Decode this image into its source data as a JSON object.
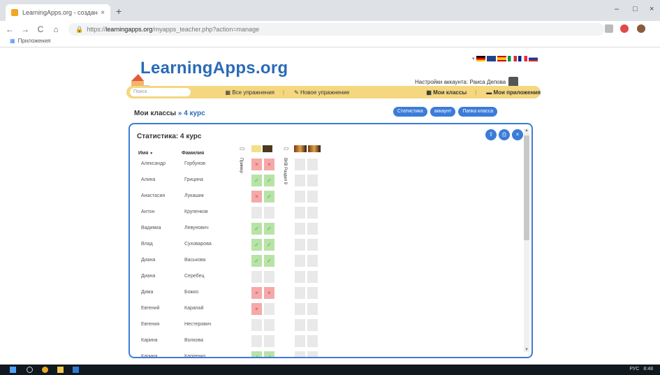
{
  "browser": {
    "tab_title": "LearningApps.org - создание м",
    "tab_close": "×",
    "new_tab": "+",
    "nav_back": "←",
    "nav_forward": "→",
    "nav_reload": "C",
    "nav_home": "⌂",
    "url_prefix": "https://",
    "url_host": "learningapps.org",
    "url_path": "/myapps_teacher.php?action=manage",
    "bookmarks_label": "Приложения",
    "win_min": "–",
    "win_max": "□",
    "win_close": "×"
  },
  "site": {
    "logo_text": "LearningApps.org",
    "account_label": "Настройки аккаунта: Раиса Депова",
    "search_placeholder": "Поиск",
    "menu": {
      "all_exercises": "Все упражнения",
      "new_exercise": "Новое упражнение",
      "my_classes": "Мои классы",
      "my_apps": "Мои приложения"
    }
  },
  "breadcrumb": {
    "root": "Мои классы",
    "sep": "»",
    "current": "4 курс"
  },
  "top_buttons": {
    "stats": "Статистика",
    "accounts": "аккаунт",
    "class_folder": "Папка класса"
  },
  "panel": {
    "title": "Статистика: 4 курс",
    "col_first": "Имя",
    "col_last": "Фамилия",
    "sort_arrow": "▼",
    "app1_label": "Пример",
    "app2_label": "ВКВ Раздел 9"
  },
  "students": [
    {
      "first": "Александр",
      "last": "Горбунов"
    },
    {
      "first": "Алина",
      "last": "Грицина"
    },
    {
      "first": "Анастасия",
      "last": "Лукашик"
    },
    {
      "first": "Антон",
      "last": "Крупенков"
    },
    {
      "first": "Вадимка",
      "last": "Левунович"
    },
    {
      "first": "Влад",
      "last": "Суховарова"
    },
    {
      "first": "Диана",
      "last": "Васькова"
    },
    {
      "first": "Диана",
      "last": "Серебец"
    },
    {
      "first": "Дима",
      "last": "Божко"
    },
    {
      "first": "Евгений",
      "last": "Карапай"
    },
    {
      "first": "Евгения",
      "last": "Нестерович"
    },
    {
      "first": "Карина",
      "last": "Волкова"
    },
    {
      "first": "Карина",
      "last": "Карпенко"
    }
  ],
  "results_col1": [
    "bad",
    "ok",
    "bad",
    "none",
    "ok",
    "ok",
    "ok",
    "none",
    "bad",
    "bad",
    "none",
    "none",
    "ok"
  ],
  "results_col2": [
    "bad",
    "ok",
    "ok",
    "none",
    "ok",
    "ok",
    "ok",
    "none",
    "bad",
    "none",
    "none",
    "none",
    "ok"
  ],
  "marks": {
    "ok": "✓",
    "bad": "×"
  },
  "taskbar": {
    "lang": "РУС",
    "time": "8:48"
  },
  "colors": {
    "accent_blue": "#3b7cd8",
    "menu_yellow": "#f4d77f",
    "ok_green": "#b7e3a6",
    "bad_red": "#f5a9a9"
  }
}
